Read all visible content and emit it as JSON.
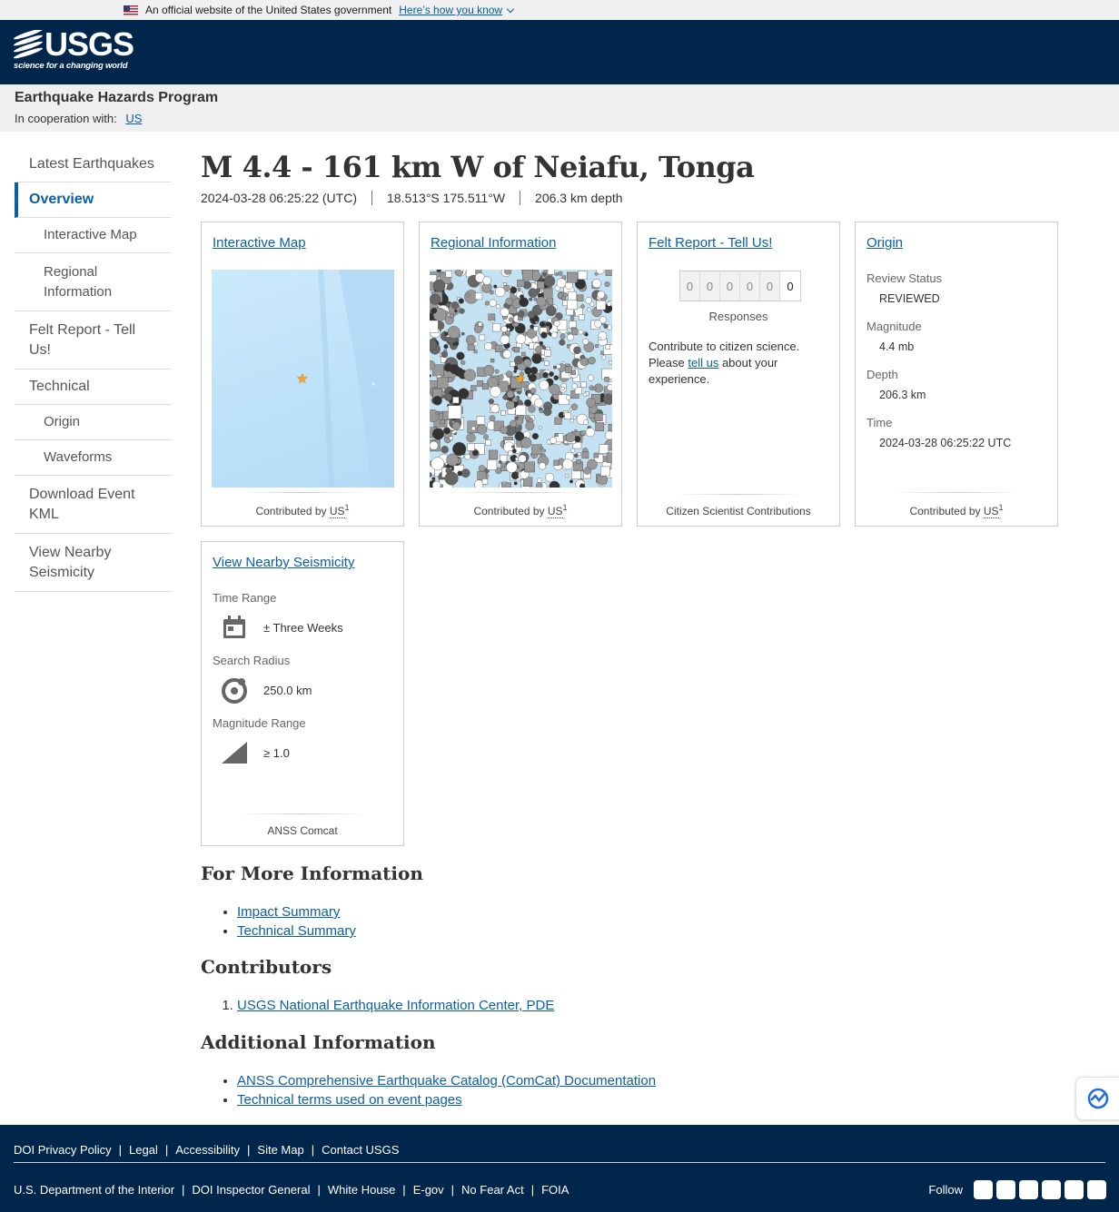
{
  "gov_banner": {
    "text": "An official website of the United States government",
    "link": "Here’s how you know"
  },
  "logo": {
    "text": "USGS",
    "tagline": "science for a changing world"
  },
  "program": {
    "title": "Earthquake Hazards Program",
    "coop_label": "In cooperation with:",
    "coop_link": "US"
  },
  "sidebar": {
    "items": [
      {
        "label": "Latest Earthquakes"
      },
      {
        "label": "Overview"
      },
      {
        "label": "Interactive Map"
      },
      {
        "label": "Regional Information"
      },
      {
        "label": "Felt Report - Tell Us!"
      },
      {
        "label": "Technical"
      },
      {
        "label": "Origin"
      },
      {
        "label": "Waveforms"
      },
      {
        "label": "Download Event KML"
      },
      {
        "label": "View Nearby Seismicity"
      }
    ]
  },
  "event": {
    "title": "M 4.4 - 161 km W of Neiafu, Tonga",
    "time": "2024-03-28 06:25:22 (UTC)",
    "location": "18.513°S 175.511°W",
    "depth": "206.3 km depth"
  },
  "cards": {
    "interactive_map": {
      "title": "Interactive Map",
      "foot_prefix": "Contributed by ",
      "foot_net": "US",
      "foot_sup": "1"
    },
    "regional": {
      "title": "Regional Information",
      "foot_prefix": "Contributed by ",
      "foot_net": "US",
      "foot_sup": "1"
    },
    "felt": {
      "title": "Felt Report - Tell Us!",
      "digits": [
        "0",
        "0",
        "0",
        "0",
        "0",
        "0"
      ],
      "responses": "Responses",
      "text_1": "Contribute to citizen science. Please ",
      "link": "tell us",
      "text_2": " about your experience.",
      "foot": "Citizen Scientist Contributions"
    },
    "origin": {
      "title": "Origin",
      "review_label": "Review Status",
      "review_value": "REVIEWED",
      "magnitude_label": "Magnitude",
      "magnitude_value": "4.4 mb",
      "depth_label": "Depth",
      "depth_value": "206.3 km",
      "time_label": "Time",
      "time_value": "2024-03-28 06:25:22 UTC",
      "foot_prefix": "Contributed by ",
      "foot_net": "US",
      "foot_sup": "1"
    },
    "seismicity": {
      "title": "View Nearby Seismicity",
      "time_label": "Time Range",
      "time_value": "± Three Weeks",
      "radius_label": "Search Radius",
      "radius_value": "250.0 km",
      "mag_label": "Magnitude Range",
      "mag_value": "≥ 1.0",
      "foot": "ANSS Comcat"
    }
  },
  "more_info": {
    "heading": "For More Information",
    "links": [
      "Impact Summary",
      "Technical Summary"
    ]
  },
  "contributors": {
    "heading": "Contributors",
    "links": [
      "USGS National Earthquake Information Center, PDE"
    ]
  },
  "additional": {
    "heading": "Additional Information",
    "links": [
      "ANSS Comprehensive Earthquake Catalog (ComCat) Documentation",
      "Technical terms used on event pages"
    ]
  },
  "footer": {
    "row1": [
      "DOI Privacy Policy",
      "Legal",
      "Accessibility",
      "Site Map",
      "Contact USGS"
    ],
    "row2": [
      "U.S. Department of the Interior",
      "DOI Inspector General",
      "White House",
      "E-gov",
      "No Fear Act",
      "FOIA"
    ],
    "follow": "Follow",
    "social": [
      "twitter-icon",
      "facebook-icon",
      "github-icon",
      "flickr-icon",
      "youtube-icon",
      "instagram-icon"
    ]
  },
  "colors": {
    "header_bg": "#00264c",
    "link": "#0b5fa5",
    "star": "#f4a623"
  }
}
